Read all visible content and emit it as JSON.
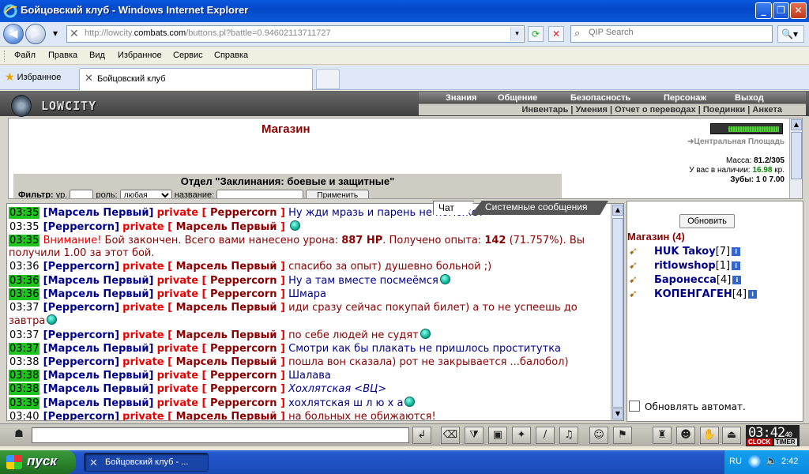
{
  "window": {
    "title": "Бойцовский клуб - Windows Internet Explorer"
  },
  "address": {
    "url_prefix": "http://lowcity.",
    "url_domain": "combats.com",
    "url_rest": "/buttons.pl?battle=0.94602113711727"
  },
  "search": {
    "placeholder": "QIP Search"
  },
  "menu": {
    "items": [
      "Файл",
      "Правка",
      "Вид",
      "Избранное",
      "Сервис",
      "Справка"
    ]
  },
  "tabs": {
    "favorites_label": "Избранное",
    "active_tab": "Бойцовский клуб"
  },
  "game": {
    "logo_text": "LOWCITY",
    "top_nav": [
      "Знания",
      "Общение",
      "Безопасность",
      "Персонаж",
      "Выход"
    ],
    "sub_nav": "Инвентарь | Умения | Отчет о переводах | Поединки | Анкета",
    "shop_title": "Магазин",
    "location": "Центральная Площадь",
    "mass_label": "Масса:",
    "mass_value": "81.2/305",
    "cash_label": "У вас в наличии:",
    "cash_value": "16.98",
    "cash_unit": "кр.",
    "teeth_label": "Зубы:",
    "teeth_value": "1 0 7.00",
    "department": "Отдел \"Заклинания: боевые и защитные\"",
    "filter_label": "Фильтр:",
    "filter_level_label": "ур.",
    "filter_role_label": "роль:",
    "filter_role_value": "любая",
    "filter_name_label": "название:",
    "filter_apply": "Применить"
  },
  "chat_tabs": {
    "chat": "Чат",
    "system": "Системные сообщения"
  },
  "chat": {
    "lines": [
      {
        "time": "03:35",
        "hl": true,
        "from": "Марсель Первый",
        "to": "Peppercorn",
        "text": "Ну жди мразь и парень не поможет",
        "smile": false
      },
      {
        "time": "03:35",
        "hl": false,
        "from": "Peppercorn",
        "to": "Марсель Первый",
        "text": "",
        "smile": true
      },
      {
        "time": "03:35",
        "hl": true,
        "system": true,
        "warn": "Внимание!",
        "text1": " Бой закончен. Всего вами нанесено урона: ",
        "dmg": "887 HP",
        "text2": ". Получено опыта: ",
        "exp": "142",
        "text3": " (71.757%). Вы получили ",
        "gain": "1.00",
        "text4": " за этот бой."
      },
      {
        "time": "03:36",
        "hl": false,
        "from": "Peppercorn",
        "to": "Марсель Первый",
        "text": "спасибо за опыт) душевно больной ;)",
        "smile": false,
        "maroon": true
      },
      {
        "time": "03:36",
        "hl": true,
        "from": "Марсель Первый",
        "to": "Peppercorn",
        "text": "Ну а там вместе посмеёмся",
        "smile": true
      },
      {
        "time": "03:36",
        "hl": true,
        "from": "Марсель Первый",
        "to": "Peppercorn",
        "text": "Шмара",
        "smile": false
      },
      {
        "time": "03:37",
        "hl": false,
        "from": "Peppercorn",
        "to": "Марсель Первый",
        "text": "иди сразу сейчас покупай билет) а то не успеешь до завтра",
        "smile": true,
        "maroon": true
      },
      {
        "time": "03:37",
        "hl": false,
        "from": "Peppercorn",
        "to": "Марсель Первый",
        "text": "по себе людей не судят",
        "smile": true,
        "maroon": true
      },
      {
        "time": "03:37",
        "hl": true,
        "from": "Марсель Первый",
        "to": "Peppercorn",
        "text": "Смотри как бы плакать не пришлось проститутка",
        "smile": false
      },
      {
        "time": "03:38",
        "hl": false,
        "from": "Peppercorn",
        "to": "Марсель Первый",
        "text": "пошла вон сказала) рот не закрывается ...балобол)",
        "smile": false,
        "maroon": true
      },
      {
        "time": "03:38",
        "hl": true,
        "from": "Марсель Первый",
        "to": "Peppercorn",
        "text": "Шалава",
        "smile": false
      },
      {
        "time": "03:38",
        "hl": true,
        "from": "Марсель Первый",
        "to": "Peppercorn",
        "text": "Хохлятская <ВЦ>",
        "smile": false,
        "italic": true
      },
      {
        "time": "03:39",
        "hl": true,
        "from": "Марсель Первый",
        "to": "Peppercorn",
        "text": "хохлятская ш л ю х а",
        "smile": true
      },
      {
        "time": "03:40",
        "hl": false,
        "from": "Peppercorn",
        "to": "Марсель Первый",
        "text": "на больных не обижаются!",
        "smile": false,
        "maroon": true
      }
    ],
    "private_label": "private"
  },
  "right_panel": {
    "refresh_label": "Обновить",
    "header": "Магазин (4)",
    "users": [
      {
        "name": "HUK Takoy",
        "level": "[7]"
      },
      {
        "name": "ritlowshop",
        "level": "[1]"
      },
      {
        "name": "Баронесса",
        "level": "[4]"
      },
      {
        "name": "КОПЕНГАГЕН",
        "level": "[4]"
      }
    ],
    "auto_refresh_label": "Обновлять автомат."
  },
  "clock": {
    "time": "03:42",
    "seconds": "40",
    "label_clock": "CLOCK",
    "label_timer": "TIMER"
  },
  "taskbar": {
    "start_label": "пуск",
    "task_label": "Бойцовский клуб - ...",
    "lang": "RU",
    "time": "2:42"
  }
}
